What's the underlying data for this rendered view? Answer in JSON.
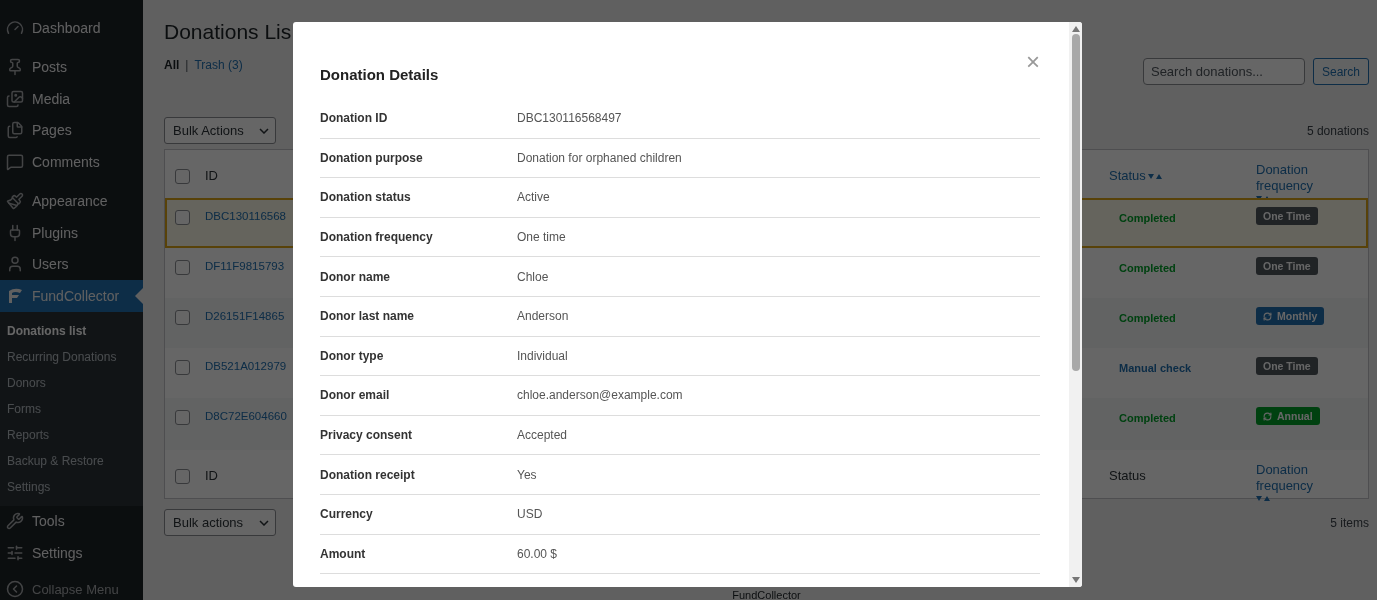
{
  "sidebar": {
    "groups": [
      {
        "items": [
          {
            "label": "Dashboard",
            "selected": false
          }
        ]
      },
      {
        "items": [
          {
            "label": "Posts",
            "selected": false
          },
          {
            "label": "Media",
            "selected": false
          },
          {
            "label": "Pages",
            "selected": false
          },
          {
            "label": "Comments",
            "selected": false
          }
        ]
      },
      {
        "items": [
          {
            "label": "Appearance",
            "selected": false
          },
          {
            "label": "Plugins",
            "selected": false
          },
          {
            "label": "Users",
            "selected": false
          },
          {
            "label": "FundCollector",
            "selected": true,
            "children": [
              {
                "label": "Donations list",
                "selected": true
              },
              {
                "label": "Recurring Donations",
                "selected": false
              },
              {
                "label": "Donors",
                "selected": false
              },
              {
                "label": "Forms",
                "selected": false
              },
              {
                "label": "Reports",
                "selected": false
              },
              {
                "label": "Backup & Restore",
                "selected": false
              },
              {
                "label": "Settings",
                "selected": false
              }
            ]
          },
          {
            "label": "Tools",
            "selected": false
          },
          {
            "label": "Settings",
            "selected": false
          }
        ]
      }
    ],
    "collapse": "Collapse Menu"
  },
  "page": {
    "title": "Donations Lis",
    "views": [
      {
        "label": "All",
        "selected": true
      },
      {
        "label": "Trash (3)",
        "selected": false
      }
    ],
    "views_separator": "|",
    "search": {
      "placeholder": "Search donations...",
      "button": "Search"
    },
    "bulk_top": "Bulk Actions",
    "count_top": "5 donations",
    "bulk_bottom": "Bulk actions",
    "count_bottom": "5 items",
    "table": {
      "header_checked": false,
      "footer_checked": false,
      "header": [
        {
          "label": "ID",
          "sortable": false
        },
        {
          "label": "Status",
          "sortable": true
        },
        {
          "label": "Donation frequency",
          "sortable": true
        }
      ],
      "footer": [
        {
          "label": "ID",
          "sortable": false
        },
        {
          "label": "Status",
          "sortable": false
        },
        {
          "label": "Donation frequency",
          "sortable": true
        }
      ],
      "rows": [
        {
          "id": "DBC130116568",
          "status": {
            "label": "Completed",
            "kind": "completed"
          },
          "frequency": {
            "label": "One Time",
            "kind": "one_time"
          },
          "checked": false,
          "selected": true
        },
        {
          "id": "DF11F9815793",
          "status": {
            "label": "Completed",
            "kind": "completed"
          },
          "frequency": {
            "label": "One Time",
            "kind": "one_time"
          },
          "checked": false,
          "selected": false
        },
        {
          "id": "D26151F14865",
          "status": {
            "label": "Completed",
            "kind": "completed"
          },
          "frequency": {
            "label": "Monthly",
            "kind": "monthly"
          },
          "checked": false,
          "selected": false
        },
        {
          "id": "DB521A012979",
          "status": {
            "label": "Manual check",
            "kind": "manual"
          },
          "frequency": {
            "label": "One Time",
            "kind": "one_time"
          },
          "checked": false,
          "selected": false
        },
        {
          "id": "D8C72E604660",
          "status": {
            "label": "Completed",
            "kind": "completed"
          },
          "frequency": {
            "label": "Annual",
            "kind": "annual"
          },
          "checked": false,
          "selected": false
        }
      ]
    },
    "footer_text": "FundCollector"
  },
  "modal": {
    "title": "Donation Details",
    "close": "×",
    "details": [
      {
        "label": "Donation ID",
        "value": "DBC130116568497"
      },
      {
        "label": "Donation purpose",
        "value": "Donation for orphaned children"
      },
      {
        "label": "Donation status",
        "value": "Active"
      },
      {
        "label": "Donation frequency",
        "value": "One time"
      },
      {
        "label": "Donor name",
        "value": "Chloe"
      },
      {
        "label": "Donor last name",
        "value": "Anderson"
      },
      {
        "label": "Donor type",
        "value": "Individual"
      },
      {
        "label": "Donor email",
        "value": "chloe.anderson@example.com"
      },
      {
        "label": "Privacy consent",
        "value": "Accepted"
      },
      {
        "label": "Donation receipt",
        "value": "Yes"
      },
      {
        "label": "Currency",
        "value": "USD"
      },
      {
        "label": "Amount",
        "value": "60.00 $"
      }
    ]
  }
}
